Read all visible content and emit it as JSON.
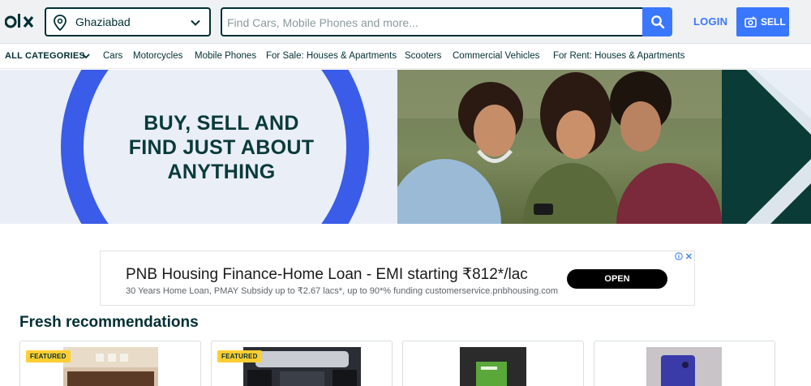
{
  "header": {
    "logo_text": "olx",
    "location": "Ghaziabad",
    "search_placeholder": "Find Cars, Mobile Phones and more...",
    "login_label": "LOGIN",
    "sell_label": "SELL",
    "accent_color": "#3a77ff"
  },
  "categories": {
    "all_label": "ALL CATEGORIES",
    "items": [
      {
        "label": "Cars"
      },
      {
        "label": "Motorcycles"
      },
      {
        "label": "Mobile Phones"
      },
      {
        "label": "For Sale: Houses & Apartments"
      },
      {
        "label": "Scooters"
      },
      {
        "label": "Commercial Vehicles"
      },
      {
        "label": "For Rent: Houses & Apartments"
      }
    ]
  },
  "hero": {
    "line1": "BUY, SELL AND",
    "line2": "FIND JUST ABOUT",
    "line3": "ANYTHING"
  },
  "ad": {
    "title": "PNB Housing Finance-Home Loan - EMI starting ₹812*/lac",
    "subtitle": "30 Years Home Loan, PMAY Subsidy up to ₹2.67 lacs*, up to 90*% funding customerservice.pnbhousing.com",
    "cta": "OPEN",
    "close": "✕"
  },
  "recommendations": {
    "title": "Fresh recommendations",
    "cards": [
      {
        "badge": "FEATURED",
        "image": "bedroom-photo"
      },
      {
        "badge": "FEATURED",
        "image": "car-interior-photo"
      },
      {
        "badge": "",
        "image": "phone-box-photo"
      },
      {
        "badge": "",
        "image": "mobile-phone-photo"
      }
    ]
  }
}
